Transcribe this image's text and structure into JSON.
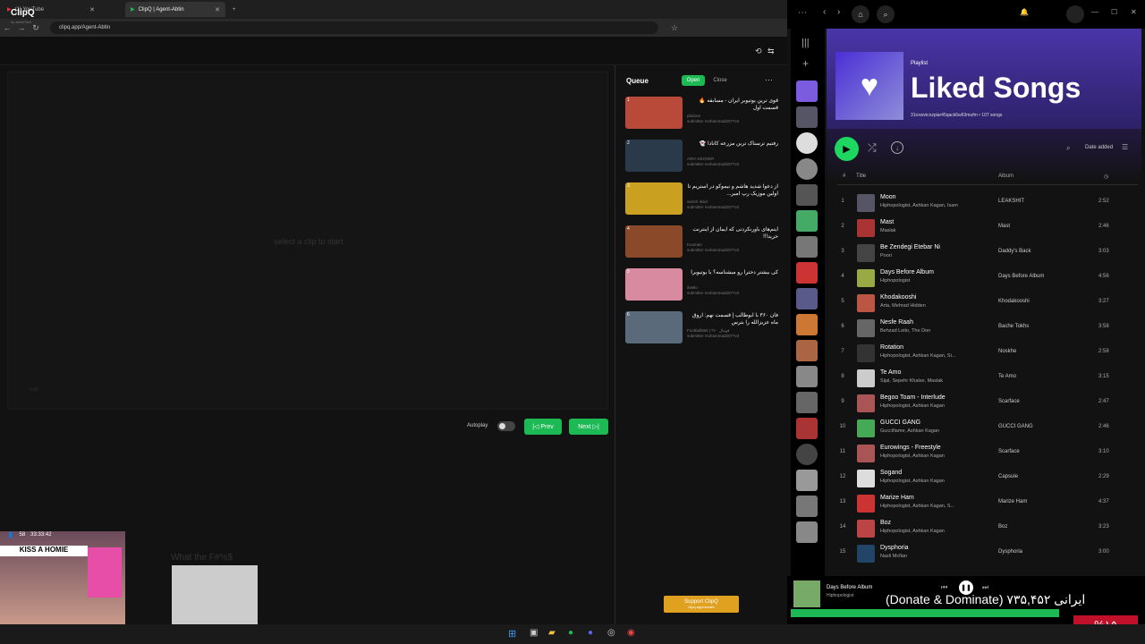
{
  "tabs": [
    {
      "label": "(1) YouTube"
    },
    {
      "label": "ClipQ | Agent-Abtin"
    }
  ],
  "url": "clipq.app/Agent-Abtin",
  "app": {
    "name": "ClipQ",
    "sub": "by awahTash"
  },
  "player": {
    "message": "select a clip to start",
    "time": "0:00"
  },
  "controls": {
    "autoplay": "Autoplay",
    "prev": "|◁ Prev",
    "next": "Next ▷|"
  },
  "queue": {
    "title": "Queue",
    "open": "Open",
    "close": "Close",
    "items": [
      {
        "n": "1",
        "title": "قوی ترین یوتیوبر ایران - مسابقه 🔥 قسمت اول",
        "channel": "pbdone",
        "sub": "submitter mohammad2077v2"
      },
      {
        "n": "2",
        "title": "رفتیم ترسناک ترین مزرعه کانادا 👻",
        "channel": "ARIA KEOXER",
        "sub": "submitter mohammad2077v2"
      },
      {
        "n": "3",
        "title": "از دعوا شدید هاشم و نیموکو در استریم تا اولین موزیک رپ امیر...",
        "channel": "switch iksid",
        "sub": "submitter mohammad2077v2"
      },
      {
        "n": "4",
        "title": "آیتم‌های باورنکردنی که ایمان از اینترنت خرید!!!",
        "channel": "Kouman",
        "sub": "submitter mohammad2077v2"
      },
      {
        "n": "5",
        "title": "کی بیشتر دخترا رو میشناسه؟ با یوتیوبرا",
        "channel": "iluMio",
        "sub": "submitter mohammad2077v2"
      },
      {
        "n": "6",
        "title": "فان ۳۶۰ با ابوطالب | قسمت نهم: آروق ماه عزیزالله را بترس",
        "channel": "Football360 | فوتبال ۳۶۰",
        "sub": "submitter mohammad2077v2"
      }
    ]
  },
  "support": {
    "label": "Support ClipQ",
    "sub": "clipq.app/donate"
  },
  "stream": {
    "viewers": "58",
    "timer": "33:33:42",
    "kiss": "KISS A HOMIE",
    "meme": "What the F#%$"
  },
  "spotify": {
    "kind": "Playlist",
    "title": "Liked Songs",
    "meta": "31oxwvicnzpiar45qack6w63mufm • 107 songs",
    "sort": "Date added",
    "col_title": "Title",
    "col_album": "Album",
    "col_num": "#",
    "tracks": [
      {
        "n": "1",
        "title": "Moon",
        "artist": "Hiphopologist, Ashkan Kagan, Isam",
        "album": "LEAKSHIT",
        "dur": "2:52",
        "color": "#556"
      },
      {
        "n": "2",
        "title": "Mast",
        "artist": "Maslak",
        "album": "Mast",
        "dur": "2:46",
        "color": "#a33"
      },
      {
        "n": "3",
        "title": "Be Zendegi Etebar Ni",
        "artist": "Poori",
        "album": "Daddy's Back",
        "dur": "3:03",
        "color": "#444"
      },
      {
        "n": "4",
        "title": "Days Before Album",
        "artist": "Hiphopologist",
        "album": "Days Before Album",
        "dur": "4:56",
        "color": "#9a4"
      },
      {
        "n": "5",
        "title": "Khodakooshi",
        "artist": "Arta, Mehrad Hidden",
        "album": "Khodakooshi",
        "dur": "3:27",
        "color": "#b54"
      },
      {
        "n": "6",
        "title": "Nesfe Raah",
        "artist": "Behzad Leito, The Don",
        "album": "Bache Tokhs",
        "dur": "3:58",
        "color": "#666"
      },
      {
        "n": "7",
        "title": "Rotation",
        "artist": "Hiphopologist, Ashkan Kagan, Si...",
        "album": "Noskhe",
        "dur": "2:58",
        "color": "#333"
      },
      {
        "n": "8",
        "title": "Te Amo",
        "artist": "Sijal, Sepehr Khalse, Maslak",
        "album": "Te Amo",
        "dur": "3:15",
        "color": "#ccc"
      },
      {
        "n": "9",
        "title": "Begoo Toam - Interlude",
        "artist": "Hiphopologist, Ashkan Kagan",
        "album": "Scarface",
        "dur": "2:47",
        "color": "#a55"
      },
      {
        "n": "10",
        "title": "GUCCI GANG",
        "artist": "Guccifiame, Ashkan Kagan",
        "album": "GUCCI GANG",
        "dur": "2:46",
        "color": "#4a5"
      },
      {
        "n": "11",
        "title": "Eurowings - Freestyle",
        "artist": "Hiphopologist, Ashkan Kagan",
        "album": "Scarface",
        "dur": "3:10",
        "color": "#a55"
      },
      {
        "n": "12",
        "title": "Sogand",
        "artist": "Hiphopologist, Ashkan Kagan",
        "album": "Capsule",
        "dur": "2:29",
        "color": "#ddd"
      },
      {
        "n": "13",
        "title": "Marize Ham",
        "artist": "Hiphopologist, Ashkan Kagan, S...",
        "album": "Marize Ham",
        "dur": "4:37",
        "color": "#c33"
      },
      {
        "n": "14",
        "title": "Boz",
        "artist": "Hiphopologist, Ashkan Kagan",
        "album": "Boz",
        "dur": "3:23",
        "color": "#b44"
      },
      {
        "n": "15",
        "title": "Dysphoria",
        "artist": "Nazli Mcflan",
        "album": "Dysphoria",
        "dur": "3:00",
        "color": "#246"
      }
    ],
    "now_playing": {
      "title": "Days Before Album",
      "artist": "Hiphopologist"
    }
  },
  "overlay": {
    "donate": "(Donate & Dominate) ایرانی ۷۳۵,۴۵۲",
    "pct": "%۱۵"
  }
}
